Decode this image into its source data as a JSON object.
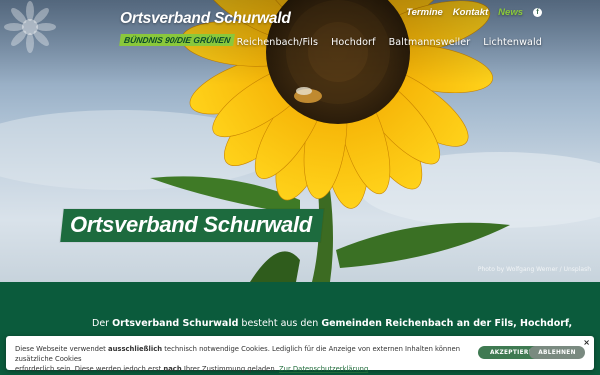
{
  "header": {
    "brand_title": "Ortsverband Schurwald",
    "brand_subtitle": "BÜNDNIS 90/DIE GRÜNEN",
    "top_links": [
      "Termine",
      "Kontakt",
      "News"
    ],
    "facebook_icon_glyph": "f",
    "nav": [
      "Reichenbach/Fils",
      "Hochdorf",
      "Baltmannsweiler",
      "Lichtenwald"
    ]
  },
  "hero": {
    "heading": "Ortsverband Schurwald",
    "credit": "Photo by Wolfgang Werner / Unsplash"
  },
  "content": {
    "intro_prefix": "Der ",
    "intro_bold1": "Ortsverband Schurwald",
    "intro_mid": " besteht aus den ",
    "intro_bold2": "Gemeinden Reichenbach an der Fils, Hochdorf,"
  },
  "cookie": {
    "line1_a": "Diese Webseite verwendet ",
    "line1_bold": "ausschließlich",
    "line1_b": " technisch notwendige Cookies. Lediglich für die Anzeige von externen Inhalten können zusätzliche Cookies",
    "line2_a": "erforderlich sein. Diese werden jedoch erst ",
    "line2_bold": "nach",
    "line2_b": " Ihrer Zustimmung geladen. ",
    "link": "Zur Datenschutzerklärung",
    "accept": "AKZEPTIEREN",
    "decline": "ABLEHNEN",
    "close": "×"
  },
  "colors": {
    "green_dark": "#0b5b3c",
    "green_accent": "#8ac83b",
    "heading_bg": "#1d6b3e"
  }
}
